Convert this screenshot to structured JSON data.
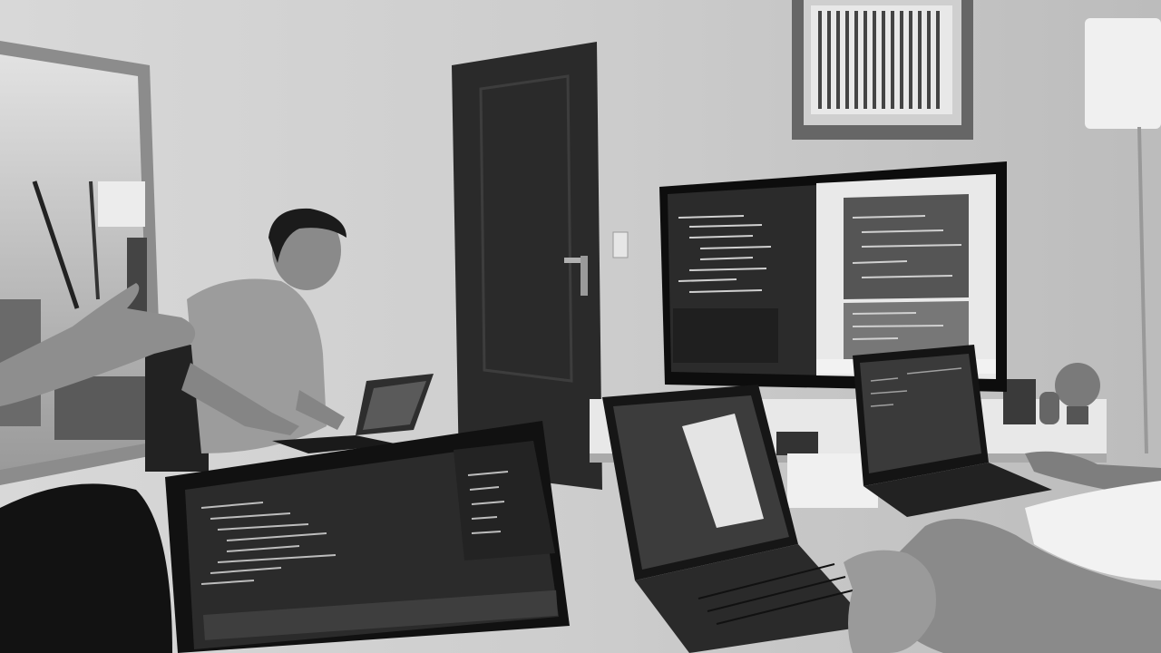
{
  "photo": {
    "style": "black-and-white",
    "colors": {
      "wall": "#cfcfcf",
      "door": "#2b2b2b",
      "screen": "#2a2a2a",
      "code_panel": "#3a3a3a",
      "dark": "#111111",
      "skin": "#8a8a8a"
    }
  }
}
